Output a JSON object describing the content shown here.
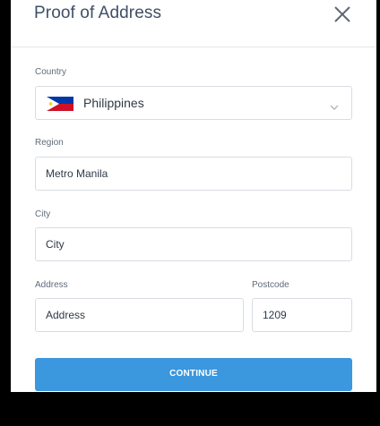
{
  "dialog": {
    "title": "Proof of Address",
    "close_icon": "close-icon"
  },
  "form": {
    "country": {
      "label": "Country",
      "value": "Philippines",
      "flag_icon": "philippines-flag-icon",
      "chevron_icon": "chevron-down-icon"
    },
    "region": {
      "label": "Region",
      "value": "Metro Manila"
    },
    "city": {
      "label": "City",
      "value": "City"
    },
    "address": {
      "label": "Address",
      "value": "Address"
    },
    "postcode": {
      "label": "Postcode",
      "value": "1209"
    },
    "continue_label": "CONTINUE"
  },
  "colors": {
    "accent": "#3b97de",
    "title_text": "#3f4f66",
    "label_text": "#5f6b7a",
    "field_border": "#d8dde3",
    "background": "#000000"
  }
}
